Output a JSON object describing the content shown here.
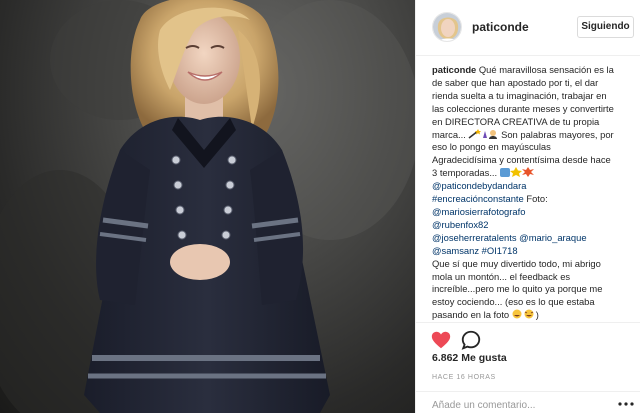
{
  "post": {
    "username": "paticonde",
    "follow_label": "Siguiendo"
  },
  "caption": {
    "username": "paticonde",
    "lines": [
      "Qué maravillosa sensación es la",
      "de saber que han apostado por ti, el dar",
      "rienda suelta a tu imaginación, trabajar en",
      "las colecciones durante meses y convertirte",
      "en DIRECTORA CREATIVA de tu propia",
      "marca...",
      "Son palabras mayores, por",
      "eso lo pongo en mayúsculas",
      "Agradecidísima y contentísima desde hace",
      "3 temporadas...",
      "@paticondebydandara",
      "#encreaciónconstante",
      " Foto:",
      "@mariosierrafotografo",
      "@rubenfox82",
      "@joseherreratalents",
      "@mario_araque",
      "@samsanz",
      "#OI1718",
      "Que sí que muy divertido todo, mi abrigo",
      "mola un montón... el feedback es",
      "increíble...pero me lo quito ya porque me",
      "estoy cociendo... (eso es lo que estaba",
      "pasando en la foto",
      ")"
    ]
  },
  "actions": {
    "like_icon": "heart-icon",
    "comment_icon": "comment-icon",
    "likes_text": "6.862 Me gusta",
    "time_text": "HACE 16 HORAS",
    "comment_placeholder": "Añade un comentario...",
    "more_icon": "more-options-icon"
  },
  "colors": {
    "like_red": "#ed4956",
    "link_blue": "#003569",
    "border": "#efefef",
    "muted_text": "#999999"
  }
}
